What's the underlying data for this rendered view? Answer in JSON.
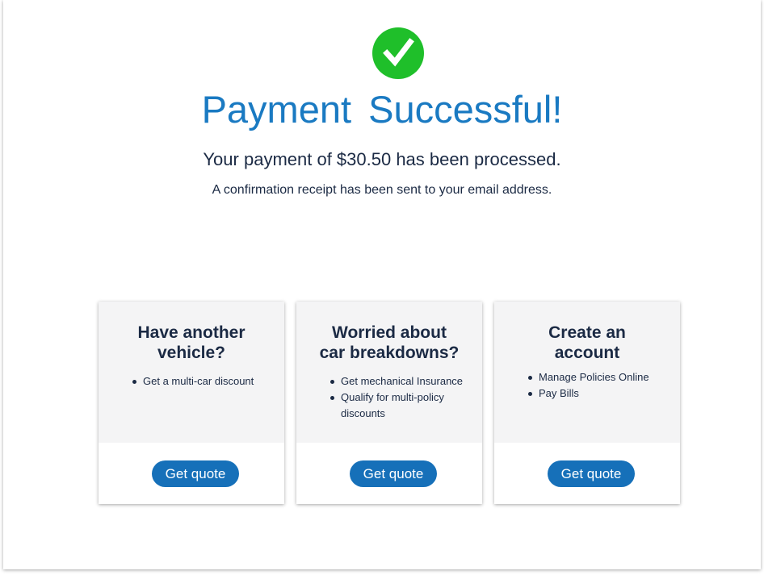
{
  "colors": {
    "accent": "#1a7ac2",
    "success": "#1fbf2a",
    "button": "#1670b9",
    "text": "#1b2a44",
    "card_top": "#f4f4f5"
  },
  "header": {
    "icon": "check-circle-icon",
    "title": "Payment Successful!",
    "message": "Your payment of $30.50 has been processed.",
    "receipt_note": "A confirmation receipt has been sent to your email address."
  },
  "cards": [
    {
      "title_line1": "Have another",
      "title_line2": "vehicle?",
      "bullets": [
        "Get a multi-car discount"
      ],
      "button_label": "Get quote"
    },
    {
      "title_line1": "Worried about",
      "title_line2": "car breakdowns?",
      "bullets": [
        "Get mechanical Insurance",
        "Qualify for multi-policy",
        "discounts"
      ],
      "button_label": "Get quote"
    },
    {
      "title_line1": "Create an",
      "title_line2": "account",
      "bullets": [
        "Manage Policies Online",
        "Pay Bills"
      ],
      "button_label": "Get quote"
    }
  ]
}
